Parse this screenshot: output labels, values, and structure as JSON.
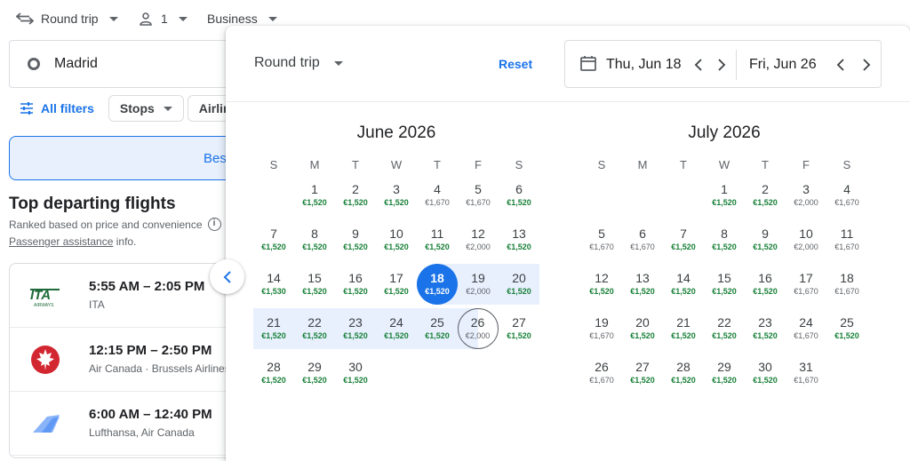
{
  "topbar": {
    "trip_type": "Round trip",
    "passengers": "1",
    "cabin": "Business"
  },
  "search": {
    "origin": "Madrid"
  },
  "filters": {
    "all_filters": "All filters",
    "stops": "Stops",
    "airlines_partial": "Airlin"
  },
  "tabs": {
    "best_partial": "Bes"
  },
  "results": {
    "title": "Top departing flights",
    "subtitle": "Ranked based on price and convenience",
    "assist_link": "Passenger assistance",
    "assist_suffix": " info.",
    "flights": [
      {
        "time": "5:55 AM – 2:05 PM",
        "airline": "ITA",
        "logo": "ita-logo"
      },
      {
        "time": "12:15 PM – 2:50 PM",
        "airline": "Air Canada · Brussels Airlines",
        "logo": "air-canada-logo"
      },
      {
        "time": "6:00 AM – 12:40 PM",
        "airline": "Lufthansa, Air Canada",
        "logo": "lufthansa-logo"
      }
    ]
  },
  "calendar": {
    "trip_type": "Round trip",
    "reset": "Reset",
    "depart_date": "Thu, Jun 18",
    "return_date": "Fri, Jun 26",
    "weekdays": [
      "S",
      "M",
      "T",
      "W",
      "T",
      "F",
      "S"
    ],
    "months": [
      {
        "title": "June 2026",
        "first_weekday": 1,
        "days": [
          {
            "d": "1",
            "p": "€1,520",
            "low": true
          },
          {
            "d": "2",
            "p": "€1,520",
            "low": true
          },
          {
            "d": "3",
            "p": "€1,520",
            "low": true
          },
          {
            "d": "4",
            "p": "€1,670",
            "low": false
          },
          {
            "d": "5",
            "p": "€1,670",
            "low": false
          },
          {
            "d": "6",
            "p": "€1,520",
            "low": true
          },
          {
            "d": "7",
            "p": "€1,520",
            "low": true
          },
          {
            "d": "8",
            "p": "€1,520",
            "low": true
          },
          {
            "d": "9",
            "p": "€1,520",
            "low": true
          },
          {
            "d": "10",
            "p": "€1,520",
            "low": true
          },
          {
            "d": "11",
            "p": "€1,520",
            "low": true
          },
          {
            "d": "12",
            "p": "€2,000",
            "low": false
          },
          {
            "d": "13",
            "p": "€1,520",
            "low": true
          },
          {
            "d": "14",
            "p": "€1,530",
            "low": true
          },
          {
            "d": "15",
            "p": "€1,520",
            "low": true
          },
          {
            "d": "16",
            "p": "€1,520",
            "low": true
          },
          {
            "d": "17",
            "p": "€1,520",
            "low": true
          },
          {
            "d": "18",
            "p": "€1,520",
            "low": true,
            "state": "depart"
          },
          {
            "d": "19",
            "p": "€2,000",
            "low": false,
            "state": "range"
          },
          {
            "d": "20",
            "p": "€1,520",
            "low": true,
            "state": "range"
          },
          {
            "d": "21",
            "p": "€1,520",
            "low": true,
            "state": "range"
          },
          {
            "d": "22",
            "p": "€1,520",
            "low": true,
            "state": "range"
          },
          {
            "d": "23",
            "p": "€1,520",
            "low": true,
            "state": "range"
          },
          {
            "d": "24",
            "p": "€1,520",
            "low": true,
            "state": "range"
          },
          {
            "d": "25",
            "p": "€1,520",
            "low": true,
            "state": "range"
          },
          {
            "d": "26",
            "p": "€2,000",
            "low": false,
            "state": "return"
          },
          {
            "d": "27",
            "p": "€1,520",
            "low": true
          },
          {
            "d": "28",
            "p": "€1,520",
            "low": true
          },
          {
            "d": "29",
            "p": "€1,520",
            "low": true
          },
          {
            "d": "30",
            "p": "€1,520",
            "low": true
          }
        ]
      },
      {
        "title": "July 2026",
        "first_weekday": 3,
        "days": [
          {
            "d": "1",
            "p": "€1,520",
            "low": true
          },
          {
            "d": "2",
            "p": "€1,520",
            "low": true
          },
          {
            "d": "3",
            "p": "€2,000",
            "low": false
          },
          {
            "d": "4",
            "p": "€1,670",
            "low": false
          },
          {
            "d": "5",
            "p": "€1,670",
            "low": false
          },
          {
            "d": "6",
            "p": "€1,670",
            "low": false
          },
          {
            "d": "7",
            "p": "€1,520",
            "low": true
          },
          {
            "d": "8",
            "p": "€1,520",
            "low": true
          },
          {
            "d": "9",
            "p": "€1,520",
            "low": true
          },
          {
            "d": "10",
            "p": "€2,000",
            "low": false
          },
          {
            "d": "11",
            "p": "€1,670",
            "low": false
          },
          {
            "d": "12",
            "p": "€1,520",
            "low": true
          },
          {
            "d": "13",
            "p": "€1,520",
            "low": true
          },
          {
            "d": "14",
            "p": "€1,520",
            "low": true
          },
          {
            "d": "15",
            "p": "€1,520",
            "low": true
          },
          {
            "d": "16",
            "p": "€1,520",
            "low": true
          },
          {
            "d": "17",
            "p": "€1,670",
            "low": false
          },
          {
            "d": "18",
            "p": "€1,670",
            "low": false
          },
          {
            "d": "19",
            "p": "€1,670",
            "low": false
          },
          {
            "d": "20",
            "p": "€1,520",
            "low": true
          },
          {
            "d": "21",
            "p": "€1,520",
            "low": true
          },
          {
            "d": "22",
            "p": "€1,520",
            "low": true
          },
          {
            "d": "23",
            "p": "€1,520",
            "low": true
          },
          {
            "d": "24",
            "p": "€1,670",
            "low": false
          },
          {
            "d": "25",
            "p": "€1,520",
            "low": true
          },
          {
            "d": "26",
            "p": "€1,670",
            "low": false
          },
          {
            "d": "27",
            "p": "€1,520",
            "low": true
          },
          {
            "d": "28",
            "p": "€1,520",
            "low": true
          },
          {
            "d": "29",
            "p": "€1,520",
            "low": true
          },
          {
            "d": "30",
            "p": "€1,520",
            "low": true
          },
          {
            "d": "31",
            "p": "€1,670",
            "low": false
          }
        ]
      }
    ]
  },
  "colors": {
    "accent": "#1a73e8",
    "low_price": "#188038",
    "range_fill": "#e8f0fe"
  }
}
